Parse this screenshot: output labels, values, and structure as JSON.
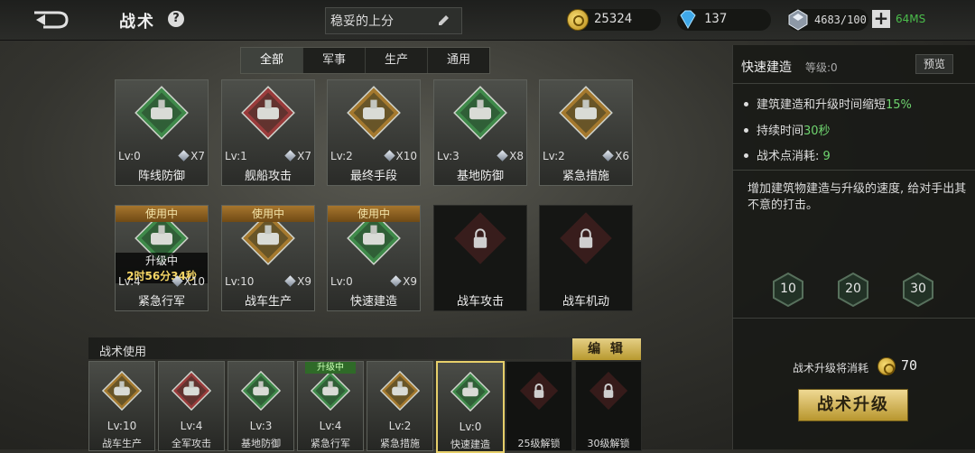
{
  "header": {
    "title": "战术",
    "help": "?",
    "preset": "稳妥的上分"
  },
  "resources": {
    "gold": "25324",
    "diamonds": "137",
    "tactic_points": "4683/100",
    "ping": "64MS"
  },
  "tabs": [
    {
      "label": "全部",
      "active": true
    },
    {
      "label": "军事",
      "active": false
    },
    {
      "label": "生产",
      "active": false
    },
    {
      "label": "通用",
      "active": false
    }
  ],
  "cards": [
    {
      "name": "阵线防御",
      "lv": "Lv:0",
      "cost": "X7",
      "color": "#3f8a4a",
      "locked": false,
      "inuse": ""
    },
    {
      "name": "舰船攻击",
      "lv": "Lv:1",
      "cost": "X7",
      "color": "#9a3b3b",
      "locked": false,
      "inuse": ""
    },
    {
      "name": "最终手段",
      "lv": "Lv:2",
      "cost": "X10",
      "color": "#a5792e",
      "locked": false,
      "inuse": ""
    },
    {
      "name": "基地防御",
      "lv": "Lv:3",
      "cost": "X8",
      "color": "#3f8a4a",
      "locked": false,
      "inuse": ""
    },
    {
      "name": "紧急措施",
      "lv": "Lv:2",
      "cost": "X6",
      "color": "#a5792e",
      "locked": false,
      "inuse": ""
    },
    {
      "name": "紧急行军",
      "lv": "Lv:4",
      "cost": "X10",
      "color": "#3f8a4a",
      "locked": false,
      "inuse": "使用中",
      "upgrading": "升级中",
      "timer": "2时56分34秒"
    },
    {
      "name": "战车生产",
      "lv": "Lv:10",
      "cost": "X9",
      "color": "#a5792e",
      "locked": false,
      "inuse": "使用中"
    },
    {
      "name": "快速建造",
      "lv": "Lv:0",
      "cost": "X9",
      "color": "#3f8a4a",
      "locked": false,
      "inuse": "使用中"
    },
    {
      "name": "战车攻击",
      "lv": "",
      "cost": "",
      "color": "#7a2a2a",
      "locked": true,
      "inuse": ""
    },
    {
      "name": "战车机动",
      "lv": "",
      "cost": "",
      "color": "#7a2a2a",
      "locked": true,
      "inuse": ""
    }
  ],
  "usage": {
    "label": "战术使用",
    "edit": "编 辑"
  },
  "slots": [
    {
      "name": "战车生产",
      "lv": "Lv:10",
      "color": "#a5792e",
      "locked": false,
      "selected": false,
      "tag": ""
    },
    {
      "name": "全军攻击",
      "lv": "Lv:4",
      "color": "#9a3b3b",
      "locked": false,
      "selected": false,
      "tag": ""
    },
    {
      "name": "基地防御",
      "lv": "Lv:3",
      "color": "#3f8a4a",
      "locked": false,
      "selected": false,
      "tag": ""
    },
    {
      "name": "紧急行军",
      "lv": "Lv:4",
      "color": "#3f8a4a",
      "locked": false,
      "selected": false,
      "tag": "升级中"
    },
    {
      "name": "紧急措施",
      "lv": "Lv:2",
      "color": "#a5792e",
      "locked": false,
      "selected": false,
      "tag": ""
    },
    {
      "name": "快速建造",
      "lv": "Lv:0",
      "color": "#3f8a4a",
      "locked": false,
      "selected": true,
      "tag": ""
    },
    {
      "name": "25级解锁",
      "lv": "",
      "color": "#7a2a2a",
      "locked": true,
      "selected": false,
      "tag": ""
    },
    {
      "name": "30级解锁",
      "lv": "",
      "color": "#7a2a2a",
      "locked": true,
      "selected": false,
      "tag": ""
    }
  ],
  "panel": {
    "title": "快速建造",
    "level": "等级:0",
    "preview": "预览",
    "effect1_pre": "建筑建造和升级时间缩短",
    "effect1_val": "15%",
    "effect2_pre": "持续时间",
    "effect2_val": "30秒",
    "effect3_pre": "战术点消耗:",
    "effect3_val": "9",
    "desc": "增加建筑物建造与升级的速度, 给对手出其不意的打击。",
    "milestones": [
      "10",
      "20",
      "30"
    ],
    "cost_label": "战术升级将消耗",
    "cost_value": "70",
    "upgrade": "战术升级"
  }
}
